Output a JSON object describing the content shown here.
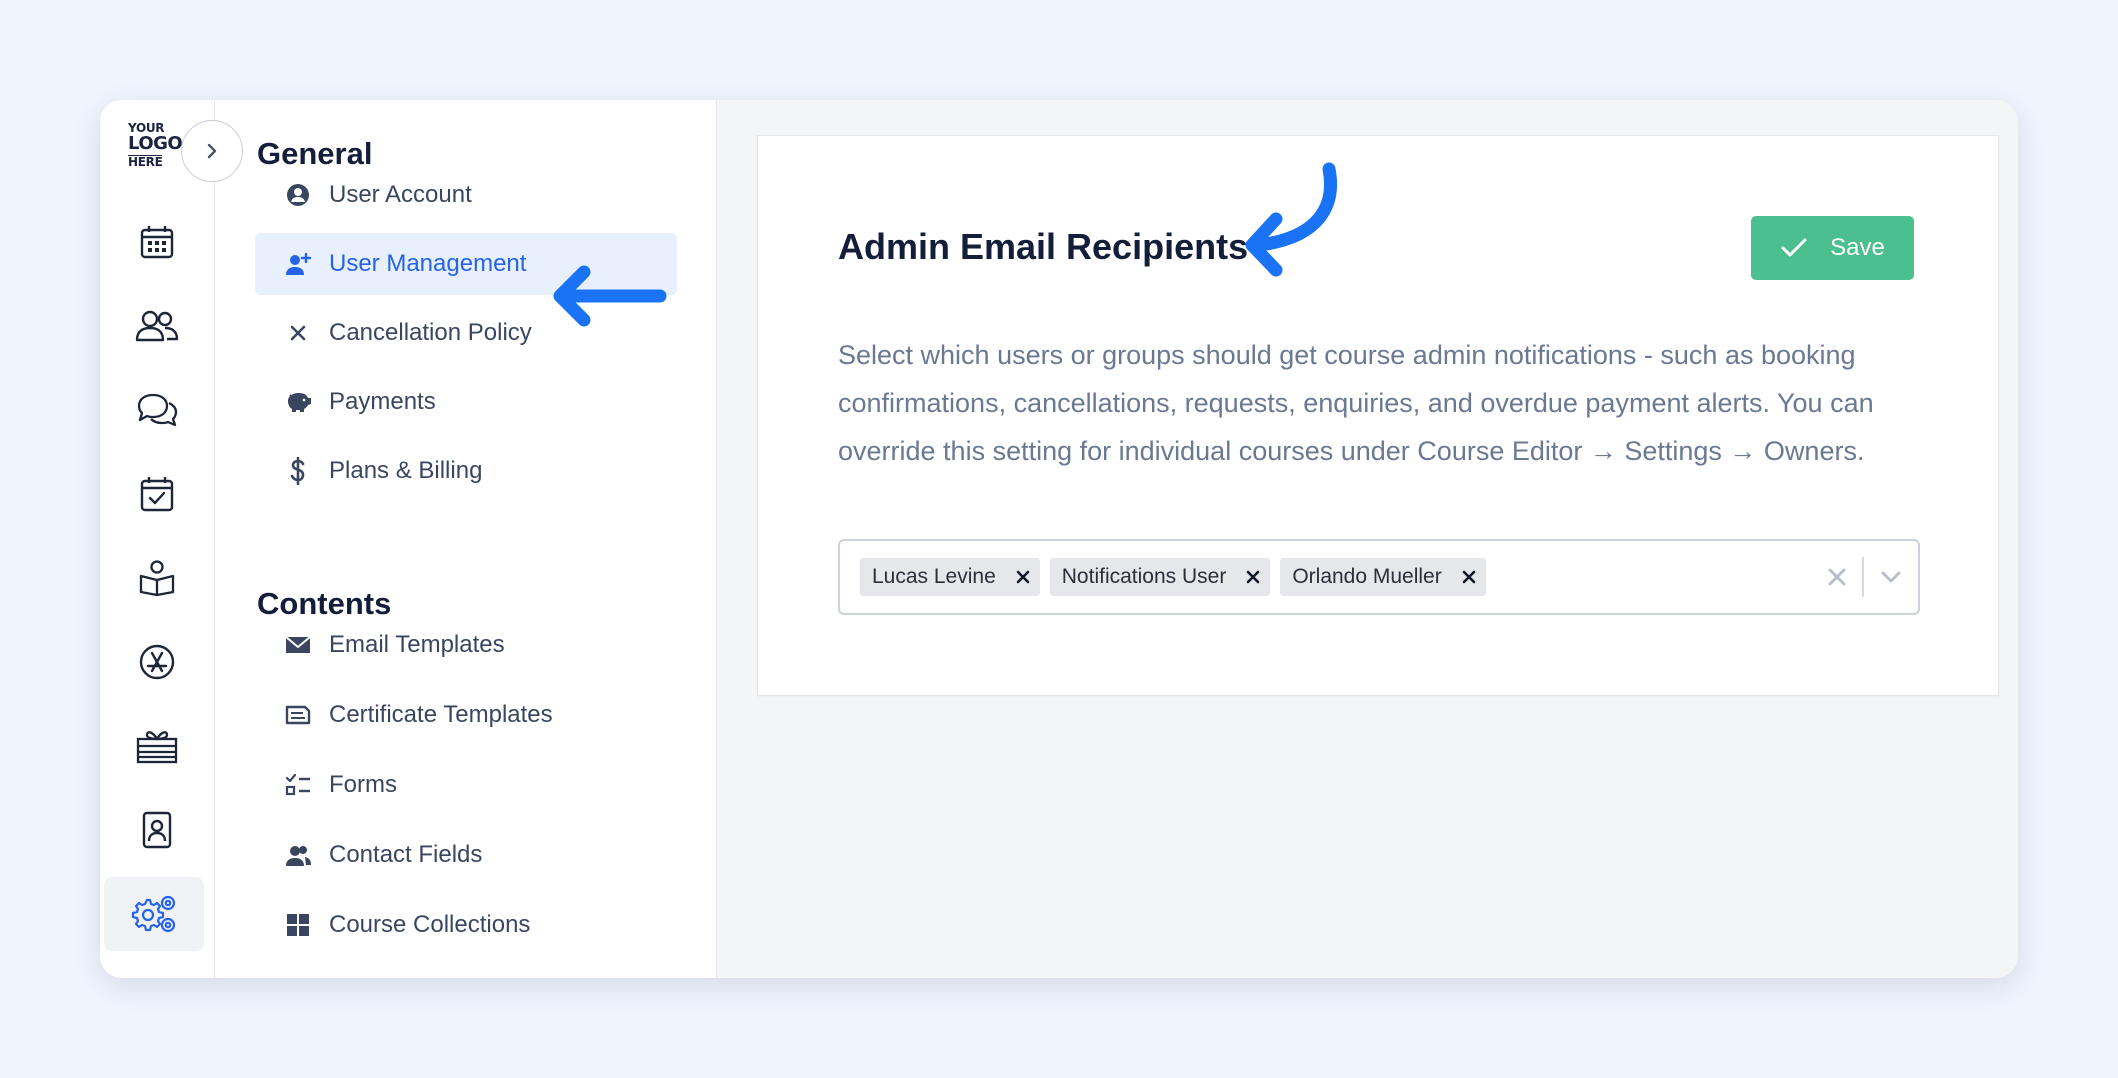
{
  "logo": {
    "line1": "YOUR",
    "line2": "LOGO",
    "line3": "HERE"
  },
  "rail": {
    "icons": [
      "calendar-icon",
      "users-icon",
      "chat-icon",
      "calendar-check-icon",
      "learner-book-icon",
      "app-store-icon",
      "gift-icon",
      "contact-card-icon",
      "settings-gears-icon"
    ],
    "active": "settings-gears-icon"
  },
  "nav": {
    "general_heading": "General",
    "general_items": [
      {
        "label": "User Account",
        "icon": "user-circle-icon"
      },
      {
        "label": "User Management",
        "icon": "user-plus-icon",
        "active": true
      },
      {
        "label": "Cancellation Policy",
        "icon": "x-icon"
      },
      {
        "label": "Payments",
        "icon": "piggy-bank-icon"
      },
      {
        "label": "Plans & Billing",
        "icon": "dollar-icon"
      }
    ],
    "contents_heading": "Contents",
    "contents_items": [
      {
        "label": "Email Templates",
        "icon": "envelope-icon"
      },
      {
        "label": "Certificate Templates",
        "icon": "certificate-icon"
      },
      {
        "label": "Forms",
        "icon": "checklist-icon"
      },
      {
        "label": "Contact Fields",
        "icon": "contacts-icon"
      },
      {
        "label": "Course Collections",
        "icon": "grid-icon"
      }
    ]
  },
  "card": {
    "title": "Admin Email Recipients",
    "save_label": "Save",
    "description": "Select which users or groups should get course admin notifications - such as booking confirmations, cancellations, requests, enquiries, and overdue payment alerts. You can override this setting for individual courses under Course Editor → Settings → Owners.",
    "selected_recipients": [
      "Lucas Levine",
      "Notifications User",
      "Orlando Mueller"
    ]
  },
  "colors": {
    "accent_blue": "#2563eb",
    "annotation_arrow": "#1a73f5",
    "save_green": "#4cbf8e",
    "page_bg": "#eff4fd"
  }
}
